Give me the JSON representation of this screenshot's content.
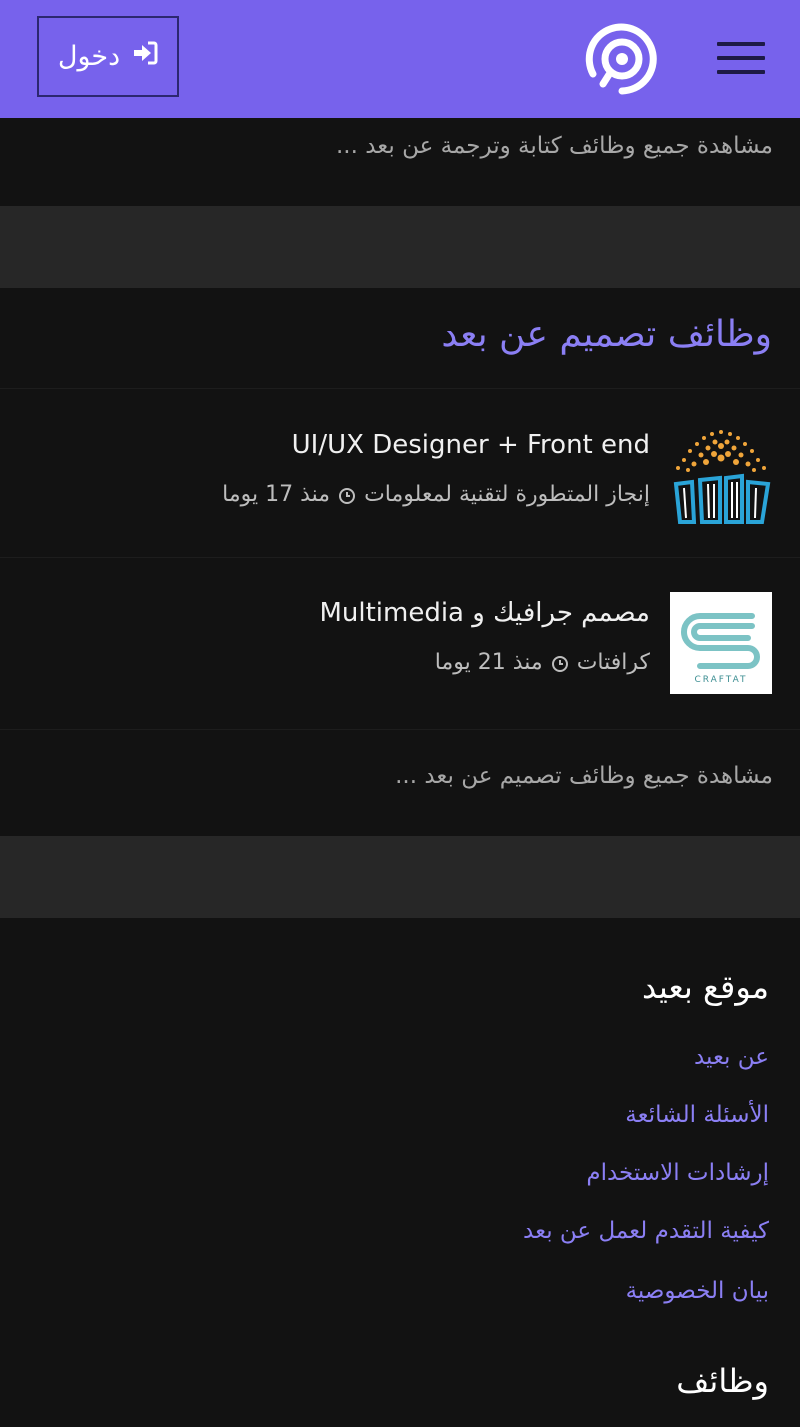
{
  "header": {
    "login_label": "دخول",
    "brand_color": "#7762ec"
  },
  "translation_section": {
    "view_all": "مشاهدة جميع وظائف كتابة وترجمة عن بعد ..."
  },
  "design_section": {
    "title": "وظائف تصميم عن بعد",
    "jobs": [
      {
        "title": "UI/UX Designer + Front end",
        "company": "إنجاز المتطورة لتقنية لمعلومات",
        "posted": "منذ 17 يوما"
      },
      {
        "title": "مصمم جرافيك و Multimedia",
        "company": "كرافتات",
        "posted": "منذ 21 يوما",
        "logo_text": "CRAFTAT"
      }
    ],
    "view_all": "مشاهدة جميع وظائف تصميم عن بعد ..."
  },
  "footer": {
    "site_title": "موقع بعيد",
    "links": [
      "عن بعيد",
      "الأسئلة الشائعة",
      "إرشادات الاستخدام",
      "كيفية التقدم لعمل عن بعد",
      "بيان الخصوصية"
    ],
    "jobs_title": "وظائف"
  }
}
